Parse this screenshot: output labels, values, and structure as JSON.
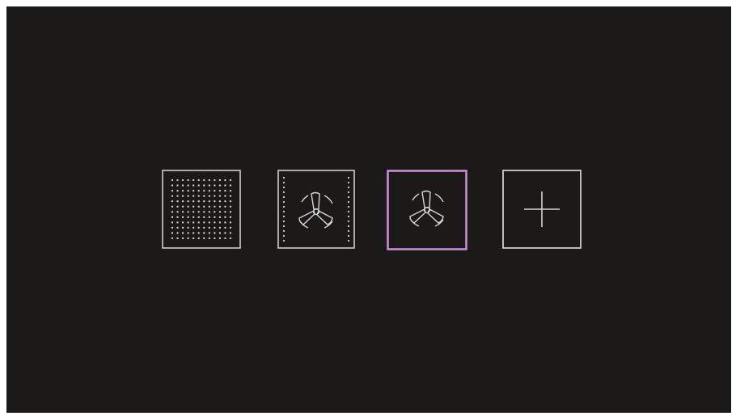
{
  "screen": {
    "background_color": "#1c1a19"
  },
  "mode_tiles": [
    {
      "icon": "dot-grid-icon",
      "selected": false,
      "border_color": "#cfcfcf"
    },
    {
      "icon": "fan-with-dotted-sides-icon",
      "selected": false,
      "border_color": "#cfcfcf"
    },
    {
      "icon": "fan-icon",
      "selected": true,
      "border_color": "#c98ad6"
    },
    {
      "icon": "plus-icon",
      "selected": false,
      "border_color": "#cfcfcf"
    }
  ]
}
